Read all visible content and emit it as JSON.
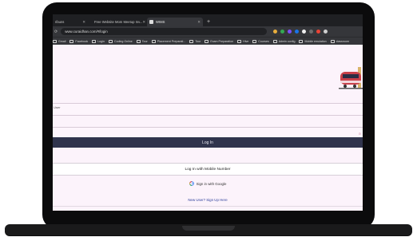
{
  "browser": {
    "tabs": [
      {
        "label": "ribuns",
        "active": false
      },
      {
        "label": "Free Website Mom Meetup Inv...",
        "active": false
      },
      {
        "label": "WIMS",
        "active": true
      }
    ],
    "new_tab": "+",
    "url": "www.curaidhan.com/#/login",
    "bookmarks": [
      "Gmail",
      "Facebook",
      "Login",
      "Coding Online",
      "Tour",
      "Placement Preparati...",
      "Tour",
      "Exam Preparation",
      "Hive",
      "Courses",
      "Admin config",
      "Mobile emulation",
      "classroom"
    ]
  },
  "login": {
    "user_label": "User",
    "password_eye": "⊙",
    "login_button": "Log In",
    "mobile_button": "Log In with Mobile Number",
    "google_button": "Sign in with Google",
    "signup_link": "New User? Sign Up Here"
  },
  "colors": {
    "page_bg": "#fcf3fb",
    "primary_button": "#30344d",
    "link": "#2a3d9a"
  }
}
